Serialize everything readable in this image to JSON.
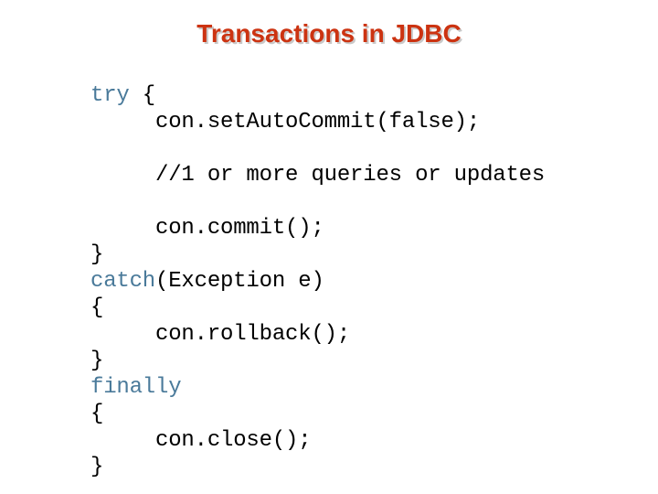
{
  "slide": {
    "title": "Transactions in JDBC",
    "title_color": "#CC3311",
    "title_shadow_color": "#C9C9C9",
    "background_color": "#FFFFFF",
    "keyword_color": "#4A7A9A",
    "code_color": "#000000"
  },
  "code": {
    "lines": [
      {
        "indent": "",
        "keyword": "try",
        "rest": " {"
      },
      {
        "indent": "     ",
        "keyword": "",
        "rest": "con.setAutoCommit(false);"
      },
      {
        "indent": "",
        "keyword": "",
        "rest": ""
      },
      {
        "indent": "     ",
        "keyword": "",
        "rest": "//1 or more queries or updates"
      },
      {
        "indent": "",
        "keyword": "",
        "rest": ""
      },
      {
        "indent": "     ",
        "keyword": "",
        "rest": "con.commit();"
      },
      {
        "indent": "",
        "keyword": "",
        "rest": "}"
      },
      {
        "indent": "",
        "keyword": "catch",
        "rest": "(Exception e)"
      },
      {
        "indent": "",
        "keyword": "",
        "rest": "{"
      },
      {
        "indent": "     ",
        "keyword": "",
        "rest": "con.rollback();"
      },
      {
        "indent": "",
        "keyword": "",
        "rest": "}"
      },
      {
        "indent": "",
        "keyword": "finally",
        "rest": ""
      },
      {
        "indent": "",
        "keyword": "",
        "rest": "{"
      },
      {
        "indent": "     ",
        "keyword": "",
        "rest": "con.close();"
      },
      {
        "indent": "",
        "keyword": "",
        "rest": "}"
      }
    ]
  }
}
